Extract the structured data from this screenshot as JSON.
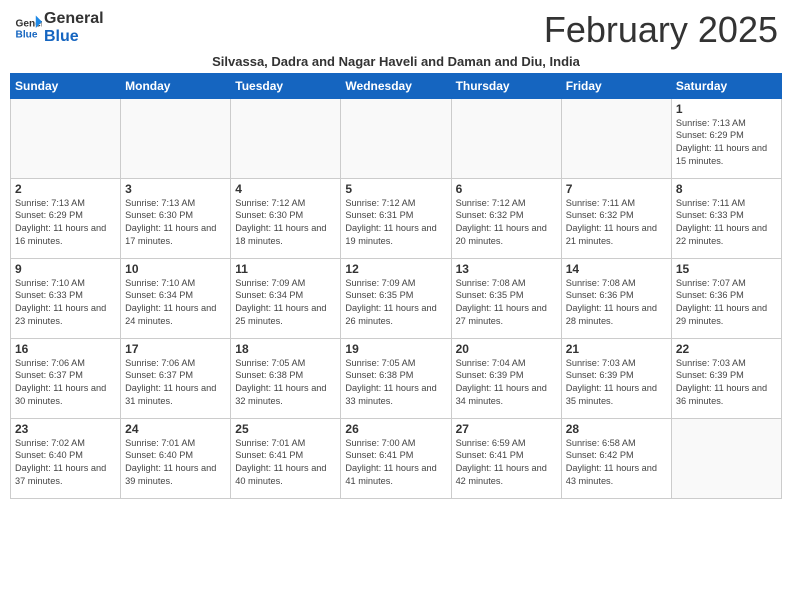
{
  "logo": {
    "general": "General",
    "blue": "Blue"
  },
  "header": {
    "month": "February 2025",
    "subtitle": "Silvassa, Dadra and Nagar Haveli and Daman and Diu, India"
  },
  "weekdays": [
    "Sunday",
    "Monday",
    "Tuesday",
    "Wednesday",
    "Thursday",
    "Friday",
    "Saturday"
  ],
  "weeks": [
    [
      {
        "day": "",
        "info": ""
      },
      {
        "day": "",
        "info": ""
      },
      {
        "day": "",
        "info": ""
      },
      {
        "day": "",
        "info": ""
      },
      {
        "day": "",
        "info": ""
      },
      {
        "day": "",
        "info": ""
      },
      {
        "day": "1",
        "info": "Sunrise: 7:13 AM\nSunset: 6:29 PM\nDaylight: 11 hours and 15 minutes."
      }
    ],
    [
      {
        "day": "2",
        "info": "Sunrise: 7:13 AM\nSunset: 6:29 PM\nDaylight: 11 hours and 16 minutes."
      },
      {
        "day": "3",
        "info": "Sunrise: 7:13 AM\nSunset: 6:30 PM\nDaylight: 11 hours and 17 minutes."
      },
      {
        "day": "4",
        "info": "Sunrise: 7:12 AM\nSunset: 6:30 PM\nDaylight: 11 hours and 18 minutes."
      },
      {
        "day": "5",
        "info": "Sunrise: 7:12 AM\nSunset: 6:31 PM\nDaylight: 11 hours and 19 minutes."
      },
      {
        "day": "6",
        "info": "Sunrise: 7:12 AM\nSunset: 6:32 PM\nDaylight: 11 hours and 20 minutes."
      },
      {
        "day": "7",
        "info": "Sunrise: 7:11 AM\nSunset: 6:32 PM\nDaylight: 11 hours and 21 minutes."
      },
      {
        "day": "8",
        "info": "Sunrise: 7:11 AM\nSunset: 6:33 PM\nDaylight: 11 hours and 22 minutes."
      }
    ],
    [
      {
        "day": "9",
        "info": "Sunrise: 7:10 AM\nSunset: 6:33 PM\nDaylight: 11 hours and 23 minutes."
      },
      {
        "day": "10",
        "info": "Sunrise: 7:10 AM\nSunset: 6:34 PM\nDaylight: 11 hours and 24 minutes."
      },
      {
        "day": "11",
        "info": "Sunrise: 7:09 AM\nSunset: 6:34 PM\nDaylight: 11 hours and 25 minutes."
      },
      {
        "day": "12",
        "info": "Sunrise: 7:09 AM\nSunset: 6:35 PM\nDaylight: 11 hours and 26 minutes."
      },
      {
        "day": "13",
        "info": "Sunrise: 7:08 AM\nSunset: 6:35 PM\nDaylight: 11 hours and 27 minutes."
      },
      {
        "day": "14",
        "info": "Sunrise: 7:08 AM\nSunset: 6:36 PM\nDaylight: 11 hours and 28 minutes."
      },
      {
        "day": "15",
        "info": "Sunrise: 7:07 AM\nSunset: 6:36 PM\nDaylight: 11 hours and 29 minutes."
      }
    ],
    [
      {
        "day": "16",
        "info": "Sunrise: 7:06 AM\nSunset: 6:37 PM\nDaylight: 11 hours and 30 minutes."
      },
      {
        "day": "17",
        "info": "Sunrise: 7:06 AM\nSunset: 6:37 PM\nDaylight: 11 hours and 31 minutes."
      },
      {
        "day": "18",
        "info": "Sunrise: 7:05 AM\nSunset: 6:38 PM\nDaylight: 11 hours and 32 minutes."
      },
      {
        "day": "19",
        "info": "Sunrise: 7:05 AM\nSunset: 6:38 PM\nDaylight: 11 hours and 33 minutes."
      },
      {
        "day": "20",
        "info": "Sunrise: 7:04 AM\nSunset: 6:39 PM\nDaylight: 11 hours and 34 minutes."
      },
      {
        "day": "21",
        "info": "Sunrise: 7:03 AM\nSunset: 6:39 PM\nDaylight: 11 hours and 35 minutes."
      },
      {
        "day": "22",
        "info": "Sunrise: 7:03 AM\nSunset: 6:39 PM\nDaylight: 11 hours and 36 minutes."
      }
    ],
    [
      {
        "day": "23",
        "info": "Sunrise: 7:02 AM\nSunset: 6:40 PM\nDaylight: 11 hours and 37 minutes."
      },
      {
        "day": "24",
        "info": "Sunrise: 7:01 AM\nSunset: 6:40 PM\nDaylight: 11 hours and 39 minutes."
      },
      {
        "day": "25",
        "info": "Sunrise: 7:01 AM\nSunset: 6:41 PM\nDaylight: 11 hours and 40 minutes."
      },
      {
        "day": "26",
        "info": "Sunrise: 7:00 AM\nSunset: 6:41 PM\nDaylight: 11 hours and 41 minutes."
      },
      {
        "day": "27",
        "info": "Sunrise: 6:59 AM\nSunset: 6:41 PM\nDaylight: 11 hours and 42 minutes."
      },
      {
        "day": "28",
        "info": "Sunrise: 6:58 AM\nSunset: 6:42 PM\nDaylight: 11 hours and 43 minutes."
      },
      {
        "day": "",
        "info": ""
      }
    ]
  ]
}
